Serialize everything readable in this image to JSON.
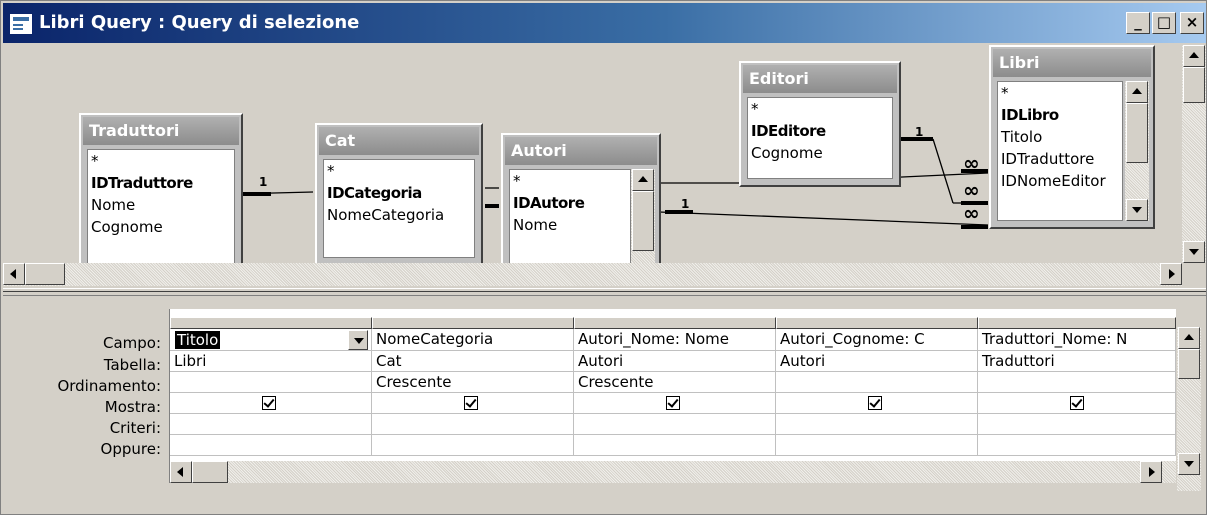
{
  "window": {
    "title": "Libri Query : Query di selezione",
    "buttons": {
      "minimize": "_",
      "maximize": "□",
      "close": "×"
    }
  },
  "diagram": {
    "tables": [
      {
        "name": "Traduttori",
        "fields": [
          "*",
          "IDTraduttore",
          "Nome",
          "Cognome"
        ],
        "key": "IDTraduttore"
      },
      {
        "name": "Cat",
        "fields": [
          "*",
          "IDCategoria",
          "NomeCategoria"
        ],
        "key": "IDCategoria"
      },
      {
        "name": "Autori",
        "fields": [
          "*",
          "IDAutore",
          "Nome"
        ],
        "key": "IDAutore"
      },
      {
        "name": "Editori",
        "fields": [
          "*",
          "IDEditore",
          "Cognome"
        ],
        "key": "IDEditore"
      },
      {
        "name": "Libri",
        "fields": [
          "*",
          "IDLibro",
          "Titolo",
          "IDTraduttore",
          "IDNomeEditor"
        ],
        "key": "IDLibro"
      }
    ],
    "relation_labels": {
      "one": "1",
      "many": "∞"
    }
  },
  "grid": {
    "row_labels": [
      "Campo:",
      "Tabella:",
      "Ordinamento:",
      "Mostra:",
      "Criteri:",
      "Oppure:"
    ],
    "columns": [
      {
        "campo": "Titolo",
        "tabella": "Libri",
        "ordinamento": "",
        "mostra": true
      },
      {
        "campo": "NomeCategoria",
        "tabella": "Cat",
        "ordinamento": "Crescente",
        "mostra": true
      },
      {
        "campo": "Autori_Nome: Nome",
        "tabella": "Autori",
        "ordinamento": "Crescente",
        "mostra": true
      },
      {
        "campo": "Autori_Cognome: C",
        "tabella": "Autori",
        "ordinamento": "",
        "mostra": true
      },
      {
        "campo": "Traduttori_Nome: N",
        "tabella": "Traduttori",
        "ordinamento": "",
        "mostra": true
      }
    ]
  },
  "colors": {
    "title_gradient_start": "#0a246a",
    "title_gradient_end": "#a6caf0",
    "face": "#d4d0c8"
  }
}
